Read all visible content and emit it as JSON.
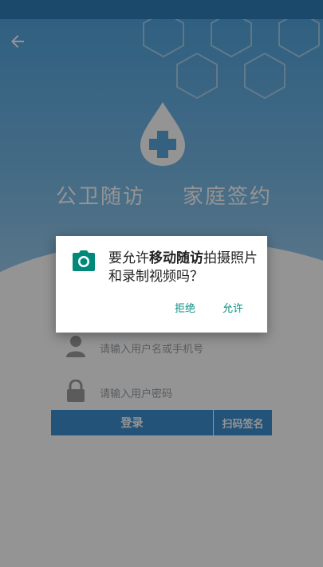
{
  "app": {
    "title_left": "公卫随访",
    "title_right": "家庭签约"
  },
  "login": {
    "username_placeholder": "请输入用户名或手机号",
    "password_placeholder": "请输入用户密码",
    "login_label": "登录",
    "scan_sign_label": "扫码签名"
  },
  "permission_dialog": {
    "prefix": "要允许",
    "app_name": "移动随访",
    "suffix": "拍摄照片和录制视频吗？",
    "deny_label": "拒绝",
    "allow_label": "允许",
    "icon": "camera-icon"
  },
  "colors": {
    "brand_blue": "#3f8fd0",
    "accent_teal": "#0a8f82"
  },
  "icons": [
    "back-arrow-icon",
    "medical-drop-icon",
    "user-icon",
    "lock-icon",
    "camera-icon"
  ]
}
